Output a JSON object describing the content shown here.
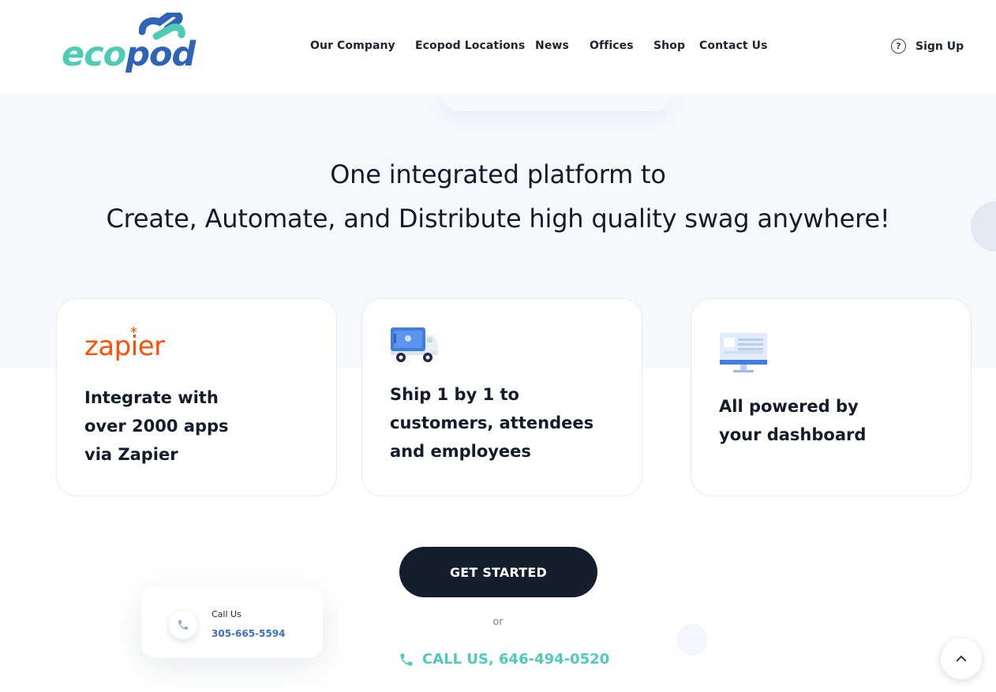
{
  "brand": {
    "logo_text_1": "eco",
    "logo_text_2": "pod",
    "colors": {
      "teal": "#4ecbb5",
      "blue": "#2f63b8",
      "dark": "#151e2c",
      "zapier": "#ff4f00",
      "call_link": "#4ec9bd"
    }
  },
  "nav": {
    "items": [
      {
        "label": "Our Company"
      },
      {
        "label": "Ecopod Locations"
      },
      {
        "label": "News"
      },
      {
        "label": "Offices"
      },
      {
        "label": "Shop"
      },
      {
        "label": "Contact Us"
      }
    ],
    "signup_label": "Sign Up",
    "help_icon": "question-circle-icon",
    "help_glyph": "?"
  },
  "hero": {
    "line1": "One integrated platform to",
    "line2": "Create, Automate, and Distribute high quality swag anywhere!"
  },
  "cards": [
    {
      "logo_text": "zapier",
      "logo_star": "*",
      "lines": [
        "Integrate with",
        "over 2000 apps",
        "via Zapier"
      ]
    },
    {
      "icon": "delivery-truck-icon",
      "lines": [
        "Ship 1 by 1 to",
        "customers, attendees",
        "and employees"
      ]
    },
    {
      "icon": "dashboard-monitor-icon",
      "lines": [
        "All powered by",
        "your dashboard"
      ]
    }
  ],
  "cta": {
    "button_label": "GET STARTED",
    "or_text": "or",
    "call_label": "CALL US, 646-494-0520"
  },
  "call_card": {
    "label": "Call Us",
    "number": "305-665-5594",
    "icon": "phone-icon"
  },
  "scroll_top": {
    "icon": "chevron-up-icon"
  }
}
